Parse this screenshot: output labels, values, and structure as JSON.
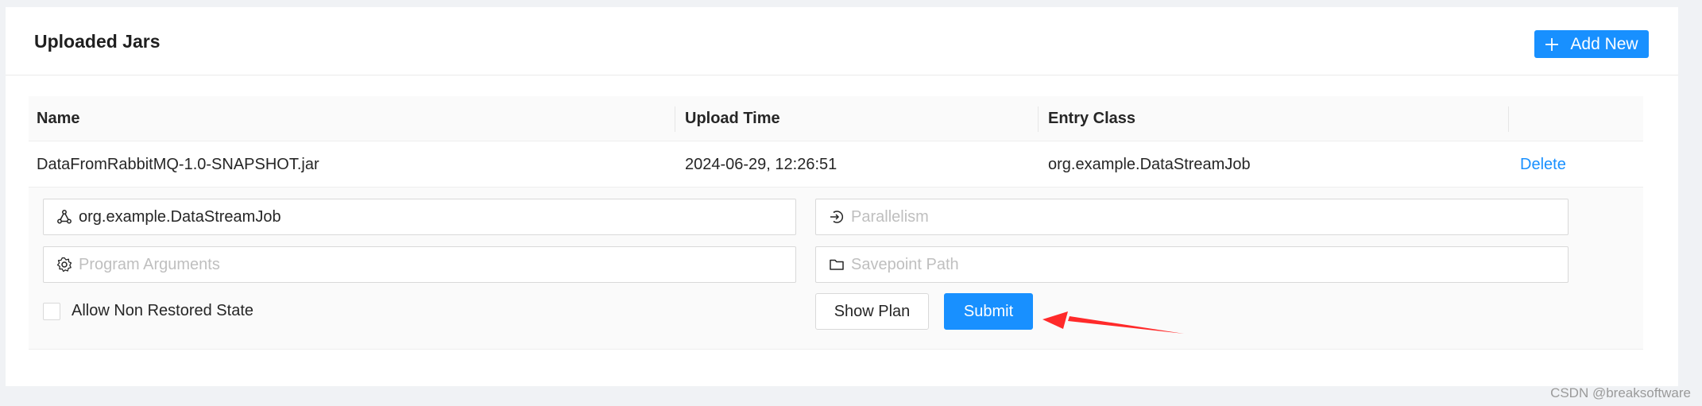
{
  "header": {
    "title": "Uploaded Jars",
    "add_button_label": "Add New"
  },
  "table": {
    "columns": [
      "Name",
      "Upload Time",
      "Entry Class",
      ""
    ],
    "rows": [
      {
        "name": "DataFromRabbitMQ-1.0-SNAPSHOT.jar",
        "upload_time": "2024-06-29, 12:26:51",
        "entry_class": "org.example.DataStreamJob",
        "action": "Delete"
      }
    ]
  },
  "submit_form": {
    "entry_class_value": "org.example.DataStreamJob",
    "parallelism_placeholder": "Parallelism",
    "program_args_placeholder": "Program Arguments",
    "savepoint_placeholder": "Savepoint Path",
    "allow_non_restored_label": "Allow Non Restored State",
    "allow_non_restored_checked": false,
    "show_plan_label": "Show Plan",
    "submit_label": "Submit"
  },
  "icons": {
    "add": "plus-icon",
    "entry_class": "cluster-icon",
    "parallelism": "login-icon",
    "program_args": "setting-icon",
    "savepoint": "folder-icon"
  },
  "colors": {
    "primary": "#1890ff",
    "annotation_arrow": "#ff2a2a"
  },
  "watermark": "CSDN @breaksoftware"
}
